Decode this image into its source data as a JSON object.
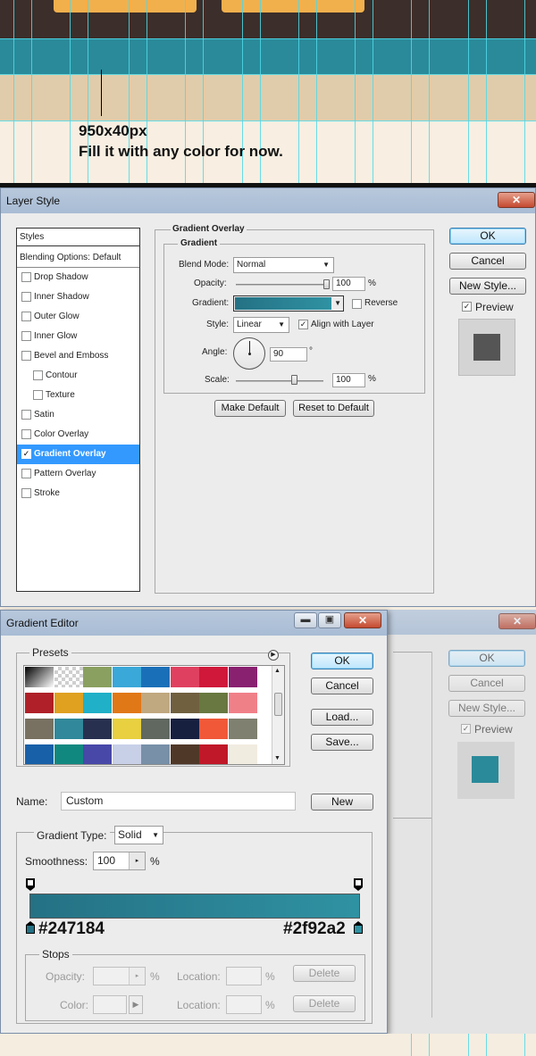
{
  "canvas": {
    "colors": {
      "dark": "#3c2e2a",
      "orange": "#f2b04d",
      "bar": "#2a8a9a",
      "tan": "#e0ccaa",
      "cream": "#f8efe2",
      "guide": "#4fd8e8"
    },
    "note_size": "950x40px",
    "note_text": "Fill it with any color for now."
  },
  "layer_style": {
    "title": "Layer Style",
    "close_label": "✕",
    "styles_header": "Styles",
    "blending_options": "Blending Options: Default",
    "items": [
      {
        "label": "Drop Shadow",
        "checked": false,
        "sub": false
      },
      {
        "label": "Inner Shadow",
        "checked": false,
        "sub": false
      },
      {
        "label": "Outer Glow",
        "checked": false,
        "sub": false
      },
      {
        "label": "Inner Glow",
        "checked": false,
        "sub": false
      },
      {
        "label": "Bevel and Emboss",
        "checked": false,
        "sub": false
      },
      {
        "label": "Contour",
        "checked": false,
        "sub": true
      },
      {
        "label": "Texture",
        "checked": false,
        "sub": true
      },
      {
        "label": "Satin",
        "checked": false,
        "sub": false
      },
      {
        "label": "Color Overlay",
        "checked": false,
        "sub": false
      },
      {
        "label": "Gradient Overlay",
        "checked": true,
        "sub": false,
        "selected": true
      },
      {
        "label": "Pattern Overlay",
        "checked": false,
        "sub": false
      },
      {
        "label": "Stroke",
        "checked": false,
        "sub": false
      }
    ],
    "section_title": "Gradient Overlay",
    "group_title": "Gradient",
    "blend_mode_label": "Blend Mode:",
    "blend_mode_value": "Normal",
    "opacity_label": "Opacity:",
    "opacity_value": "100",
    "opacity_unit": "%",
    "opacity_fraction": 1.0,
    "gradient_label": "Gradient:",
    "reverse_label": "Reverse",
    "style_label": "Style:",
    "style_value": "Linear",
    "align_label": "Align with Layer",
    "angle_label": "Angle:",
    "angle_value": "90",
    "angle_unit": "°",
    "scale_label": "Scale:",
    "scale_value": "100",
    "scale_unit": "%",
    "scale_fraction": 0.63,
    "make_default": "Make Default",
    "reset_default": "Reset to Default",
    "ok": "OK",
    "cancel": "Cancel",
    "new_style": "New Style...",
    "preview_label": "Preview"
  },
  "gradient_editor": {
    "title": "Gradient Editor",
    "close_label": "✕",
    "min_label": "▬",
    "max_label": "▣",
    "presets_label": "Presets",
    "presets_menu_icon": "arrow-right-circle-icon",
    "swatches": [
      [
        "linear-gradient(135deg,#000,#fff)",
        "checker",
        "#8aa060",
        "#3aa8d8",
        "#1a70b8",
        "#e04060",
        "#d0183a",
        "#8a2070"
      ],
      [
        "#b02028",
        "#e0a020",
        "#20b0c8",
        "#e07818",
        "#c0a880",
        "#706040",
        "#687840",
        "#f08088"
      ],
      [
        "#787060",
        "#30889a",
        "#283050",
        "#e8d040",
        "#606860",
        "#182040",
        "#f05838",
        "#808070"
      ],
      [
        "#1860a8",
        "#108880",
        "#4848a8",
        "#c8d0e8",
        "#7890a8",
        "#503828",
        "#c01828",
        "#f0ece0"
      ]
    ],
    "ok": "OK",
    "cancel": "Cancel",
    "load": "Load...",
    "save": "Save...",
    "name_label": "Name:",
    "name_value": "Custom",
    "new_label": "New",
    "gradient_type_label": "Gradient Type:",
    "gradient_type_value": "Solid",
    "smoothness_label": "Smoothness:",
    "smoothness_value": "100",
    "smoothness_unit": "%",
    "start_color": "#247184",
    "end_color": "#2f92a2",
    "start_label": "#247184",
    "end_label": "#2f92a2",
    "stops_label": "Stops",
    "stop_opacity_label": "Opacity:",
    "stop_opacity_unit": "%",
    "stop_location_label": "Location:",
    "stop_location_unit": "%",
    "delete_label": "Delete",
    "stop_color_label": "Color:"
  },
  "background_dialog": {
    "ok": "OK",
    "cancel": "Cancel",
    "new_style": "New Style...",
    "preview_label": "Preview"
  }
}
